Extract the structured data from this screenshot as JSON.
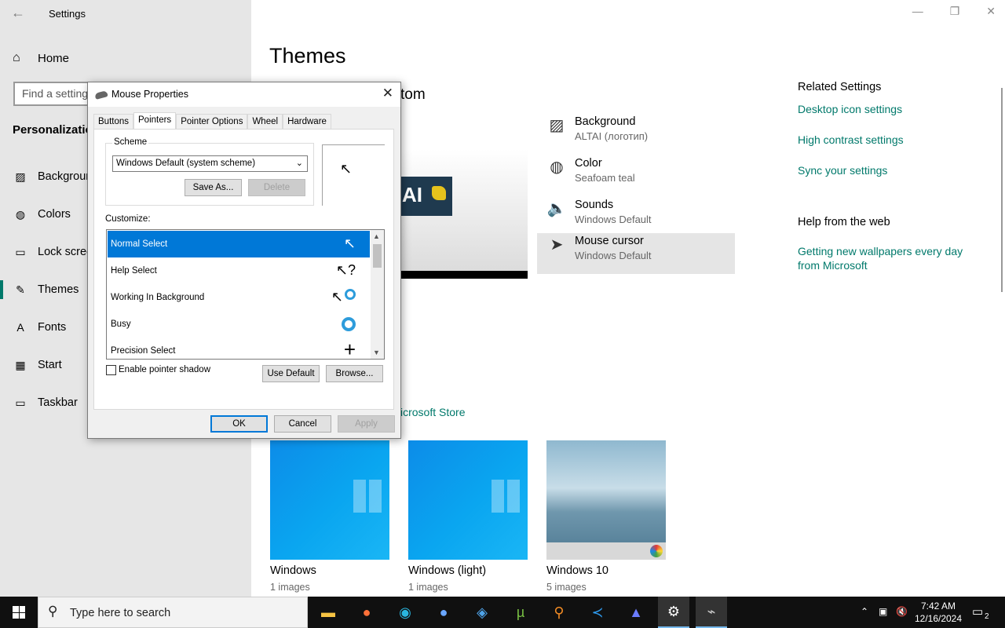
{
  "settings_window": {
    "title": "Settings",
    "back_icon": "back-arrow-icon",
    "home_label": "Home",
    "search_placeholder": "Find a setting",
    "section_title": "Personalization",
    "nav": [
      {
        "label": "Background",
        "icon": "image-icon"
      },
      {
        "label": "Colors",
        "icon": "palette-icon"
      },
      {
        "label": "Lock screen",
        "icon": "lock-screen-icon"
      },
      {
        "label": "Themes",
        "icon": "themes-icon"
      },
      {
        "label": "Fonts",
        "icon": "fonts-icon"
      },
      {
        "label": "Start",
        "icon": "start-icon"
      },
      {
        "label": "Taskbar",
        "icon": "taskbar-icon"
      }
    ]
  },
  "main": {
    "page_title": "Themes",
    "subtitle_visible": "tom",
    "theme_props": [
      {
        "title": "Background",
        "value": "ALTAI (логотип)",
        "icon": "image-icon"
      },
      {
        "title": "Color",
        "value": "Seafoam teal",
        "icon": "palette-icon"
      },
      {
        "title": "Sounds",
        "value": "Windows Default",
        "icon": "speaker-icon"
      },
      {
        "title": "Mouse cursor",
        "value": "Windows Default",
        "icon": "cursor-icon"
      }
    ],
    "preview_logo_text": "AI",
    "store_link_visible": "icrosoft Store",
    "themes": [
      {
        "name": "Windows",
        "count": "1 images"
      },
      {
        "name": "Windows (light)",
        "count": "1 images"
      },
      {
        "name": "Windows 10",
        "count": "5 images"
      }
    ],
    "related_settings": {
      "heading": "Related Settings",
      "links": [
        "Desktop icon settings",
        "High contrast settings",
        "Sync your settings"
      ]
    },
    "help": {
      "heading": "Help from the web",
      "link": "Getting new wallpapers every day from Microsoft"
    }
  },
  "dialog": {
    "title": "Mouse Properties",
    "tabs": [
      "Buttons",
      "Pointers",
      "Pointer Options",
      "Wheel",
      "Hardware"
    ],
    "selected_tab": "Pointers",
    "scheme_label": "Scheme",
    "scheme_value": "Windows Default (system scheme)",
    "save_as": "Save As...",
    "delete": "Delete",
    "customize_label": "Customize:",
    "cursors": [
      {
        "name": "Normal Select",
        "glyph": "arrow"
      },
      {
        "name": "Help Select",
        "glyph": "arrow-question"
      },
      {
        "name": "Working In Background",
        "glyph": "arrow-ring"
      },
      {
        "name": "Busy",
        "glyph": "ring"
      },
      {
        "name": "Precision Select",
        "glyph": "cross"
      }
    ],
    "shadow_label": "Enable pointer shadow",
    "use_default": "Use Default",
    "browse": "Browse...",
    "ok": "OK",
    "cancel": "Cancel",
    "apply": "Apply"
  },
  "taskbar": {
    "search_placeholder": "Type here to search",
    "time": "7:42 AM",
    "date": "12/16/2024",
    "notifications": "2",
    "apps": [
      "file-explorer-icon",
      "firefox-icon",
      "edge-icon",
      "globe-icon",
      "network-app-icon",
      "utorrent-icon",
      "search-app-icon",
      "vscode-icon",
      "app-icon",
      "settings-icon",
      "mouse-app-icon"
    ]
  },
  "colors": {
    "accent": "#00796b",
    "selection": "#0078d7",
    "taskbar": "#101010"
  }
}
